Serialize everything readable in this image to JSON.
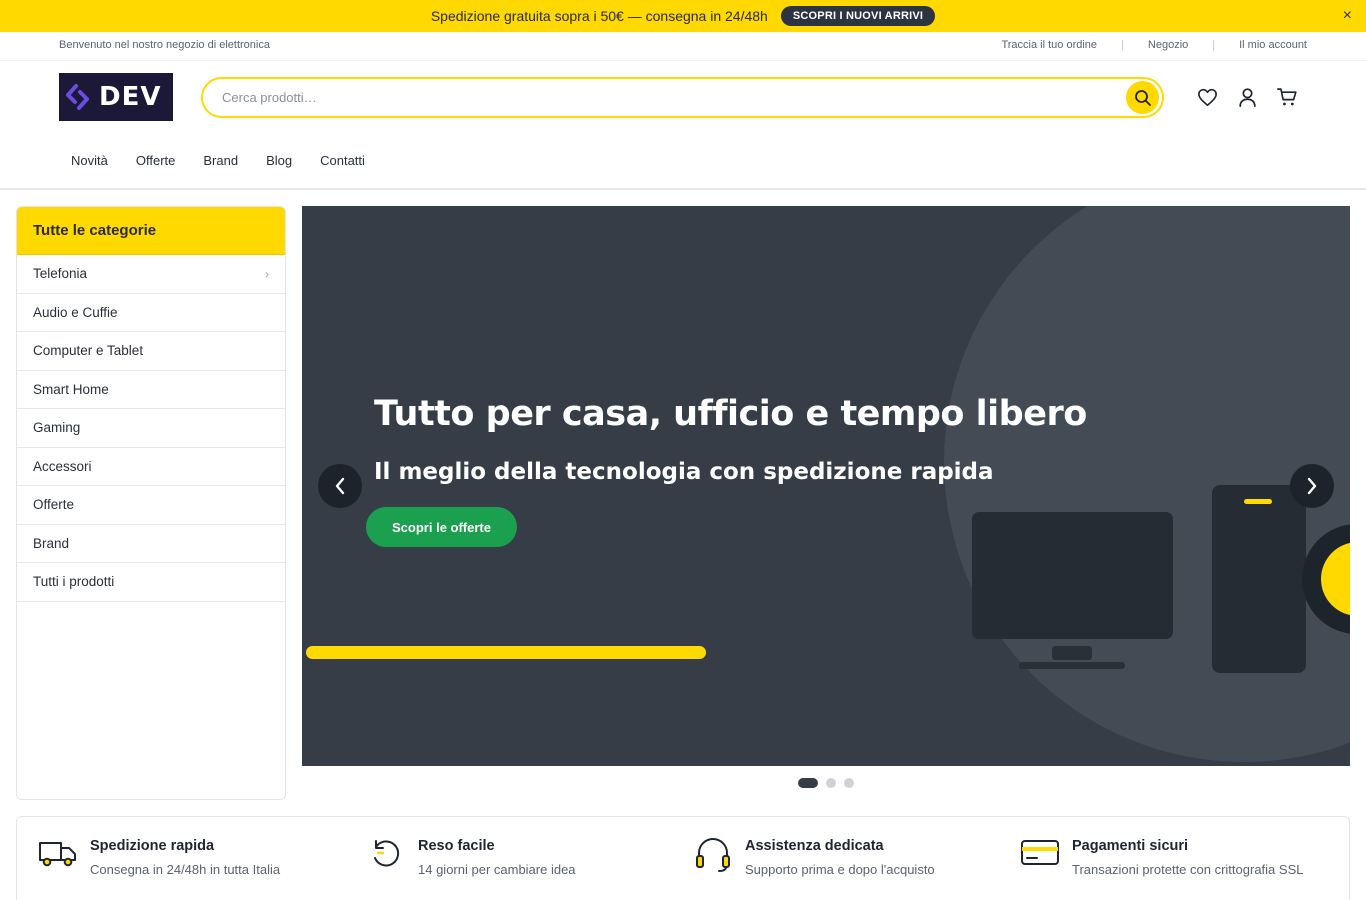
{
  "promo": {
    "text": "Spedizione gratuita sopra i 50€ — consegna in 24/48h",
    "button": "SCOPRI I NUOVI ARRIVI",
    "close": "×"
  },
  "utility": {
    "welcome": "Benvenuto nel nostro negozio di elettronica",
    "links": [
      "Traccia il tuo ordine",
      "Negozio",
      "Il mio account"
    ]
  },
  "brand": {
    "logo_text": "DEV",
    "accent": "#ffd900",
    "logo_bg": "#1b1838"
  },
  "search": {
    "placeholder": "Cerca prodotti…"
  },
  "nav": [
    "Novità",
    "Offerte",
    "Brand",
    "Blog",
    "Contatti"
  ],
  "categories": {
    "title": "Tutte le categorie",
    "items": [
      "Telefonia",
      "Audio e Cuffie",
      "Computer e Tablet",
      "Smart Home",
      "Gaming",
      "Accessori",
      "Offerte",
      "Brand",
      "Tutti i prodotti"
    ],
    "expandable_first": "›"
  },
  "hero": {
    "title": "Tutto per casa, ufficio e tempo libero",
    "subtitle": "Il meglio della tecnologia con spedizione rapida",
    "cta": "Scopri le offerte",
    "slide_count": 3,
    "active_slide": 1,
    "cta_color": "#1aa04e",
    "background": "#363d47"
  },
  "features": [
    {
      "title": "Spedizione rapida",
      "text": "Consegna in 24/48h in tutta Italia",
      "icon": "truck-icon"
    },
    {
      "title": "Reso facile",
      "text": "14 giorni per cambiare idea",
      "icon": "return-icon"
    },
    {
      "title": "Assistenza dedicata",
      "text": "Supporto prima e dopo l'acquisto",
      "icon": "headset-icon"
    },
    {
      "title": "Pagamenti sicuri",
      "text": "Transazioni protette con crittografia SSL",
      "icon": "credit-card-icon"
    }
  ]
}
